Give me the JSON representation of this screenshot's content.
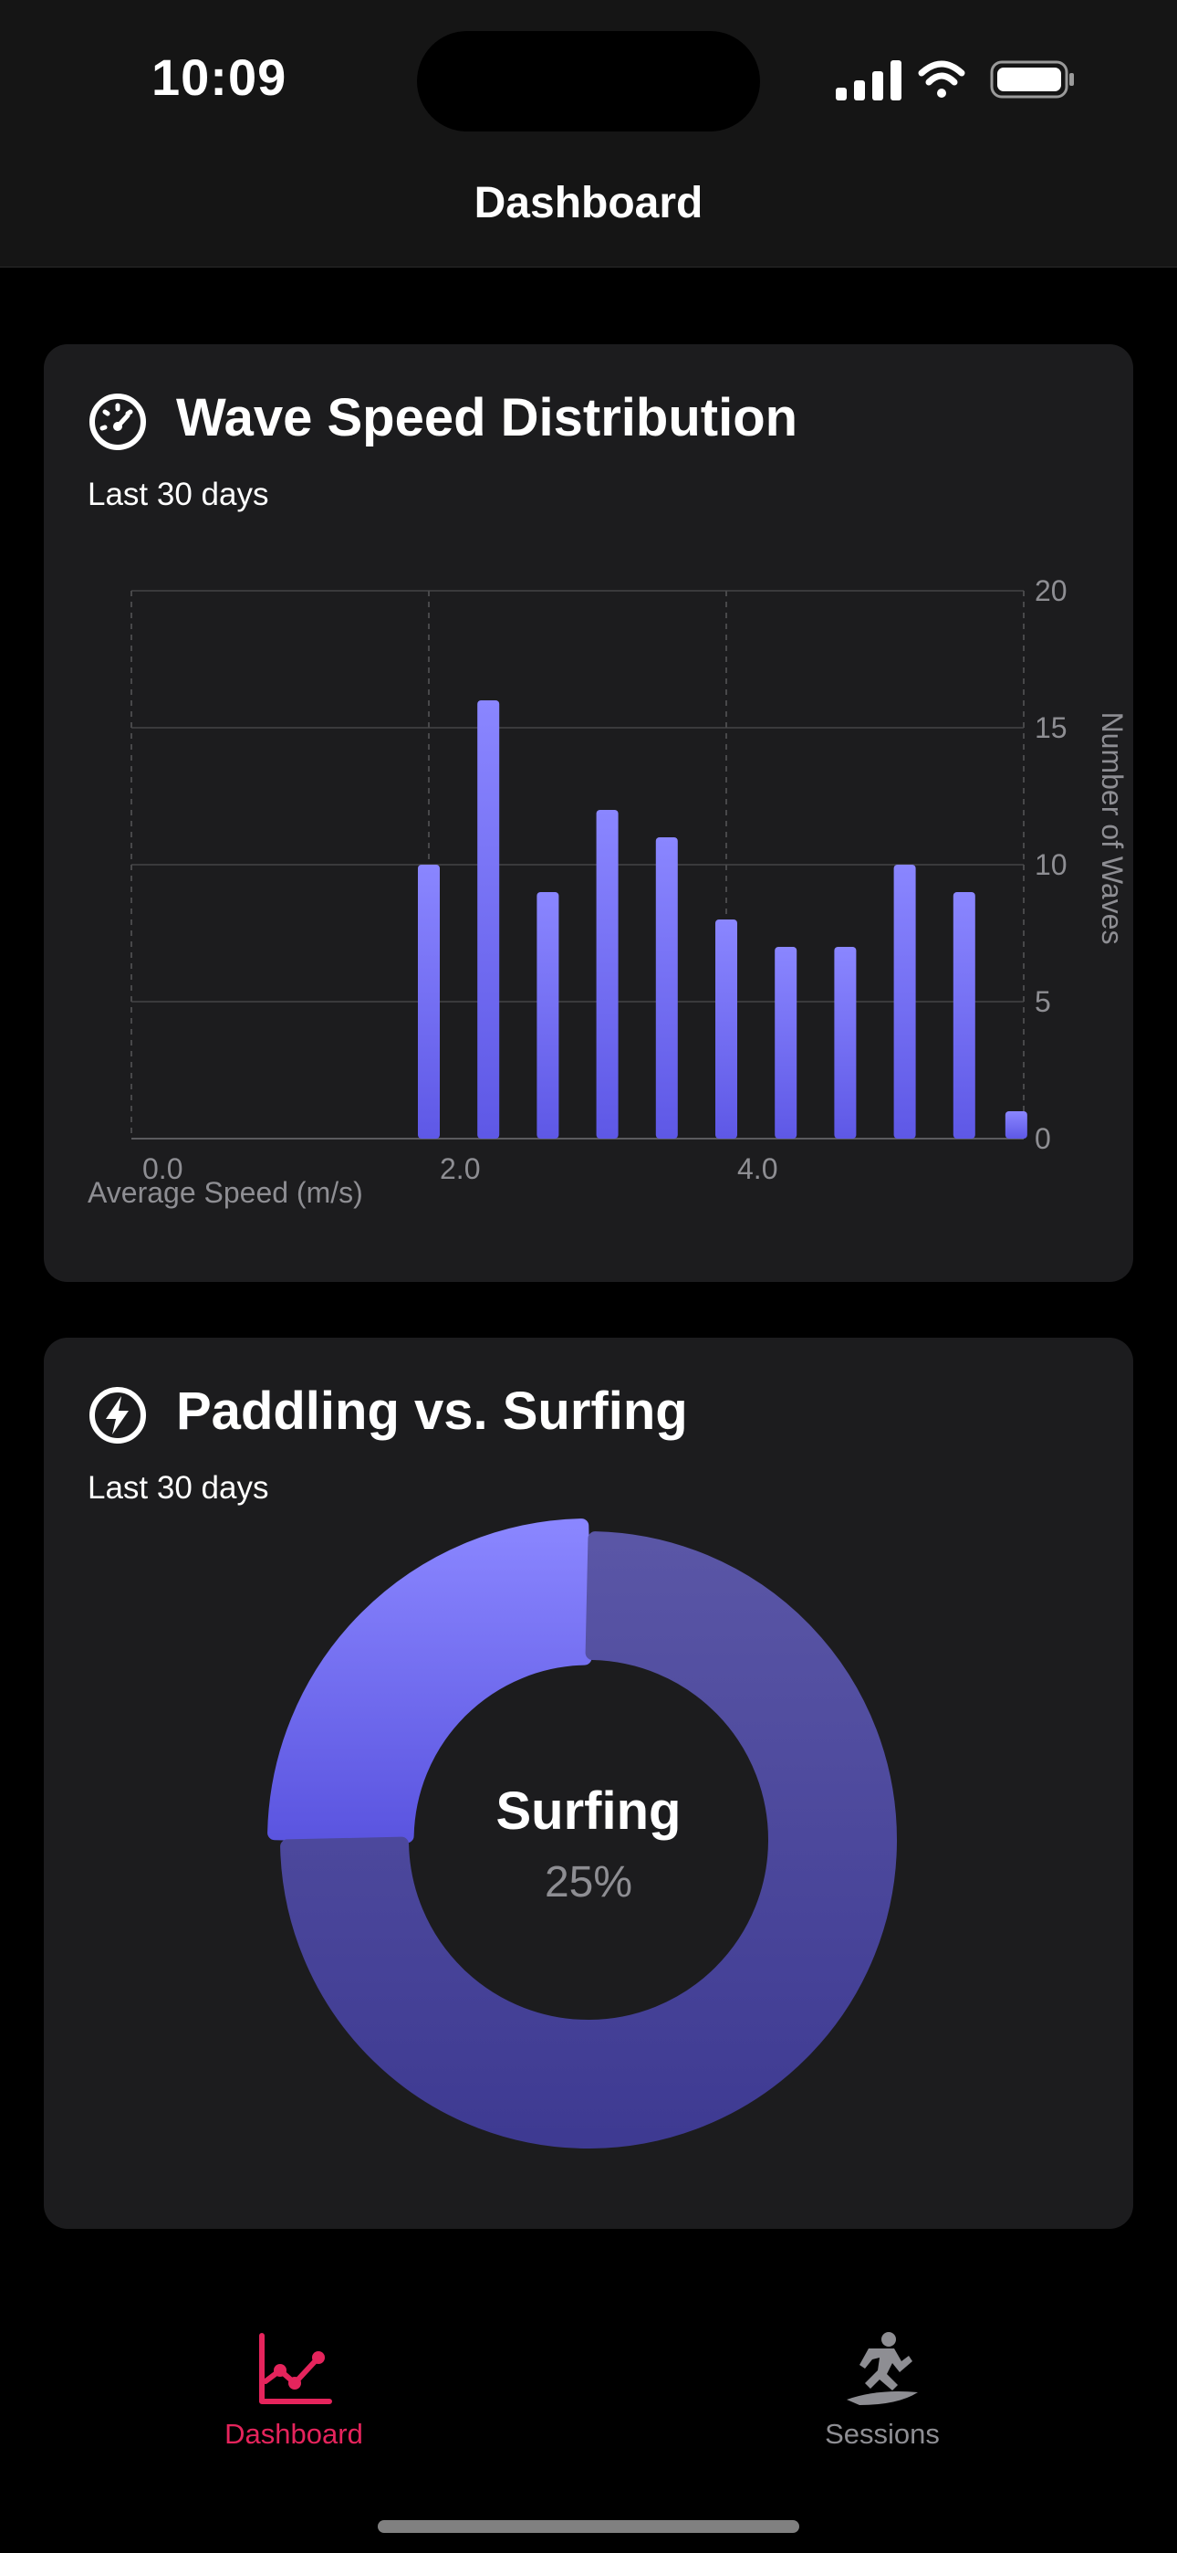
{
  "status_bar": {
    "time": "10:09"
  },
  "nav": {
    "title": "Dashboard"
  },
  "cards": {
    "wave_speed": {
      "title": "Wave Speed Distribution",
      "subtitle": "Last 30 days",
      "icon": "speedometer-icon"
    },
    "paddling": {
      "title": "Paddling vs. Surfing",
      "subtitle": "Last 30 days",
      "icon": "bolt-icon",
      "center_label": "Surfing",
      "center_value": "25%"
    }
  },
  "chart_data": [
    {
      "type": "bar",
      "xlabel": "Average Speed (m/s)",
      "ylabel": "Number of Waves",
      "x_ticks": [
        "0.0",
        "2.0",
        "4.0"
      ],
      "y_ticks": [
        "0",
        "5",
        "10",
        "15",
        "20"
      ],
      "xlim": [
        0,
        6
      ],
      "ylim": [
        0,
        20
      ],
      "grid": true,
      "y_axis_position": "right",
      "bar_color_top": "#8a86ff",
      "bar_color_bottom": "#5e58e6",
      "x": [
        2.0,
        2.4,
        2.8,
        3.2,
        3.6,
        4.0,
        4.4,
        4.8,
        5.2,
        5.6,
        5.95
      ],
      "values": [
        10,
        16,
        9,
        12,
        11,
        8,
        7,
        7,
        10,
        9,
        1
      ]
    },
    {
      "type": "pie",
      "style": "donut",
      "slices": [
        {
          "label": "Surfing",
          "value": 25,
          "color": "#7a74f5"
        },
        {
          "label": "Paddling",
          "value": 75,
          "color": "#4e4aa8"
        }
      ]
    }
  ],
  "tabs": [
    {
      "label": "Dashboard",
      "icon": "chart-line-icon",
      "active": true,
      "color": "#e5245c"
    },
    {
      "label": "Sessions",
      "icon": "surfer-icon",
      "active": false,
      "color": "#8e8e93"
    }
  ]
}
